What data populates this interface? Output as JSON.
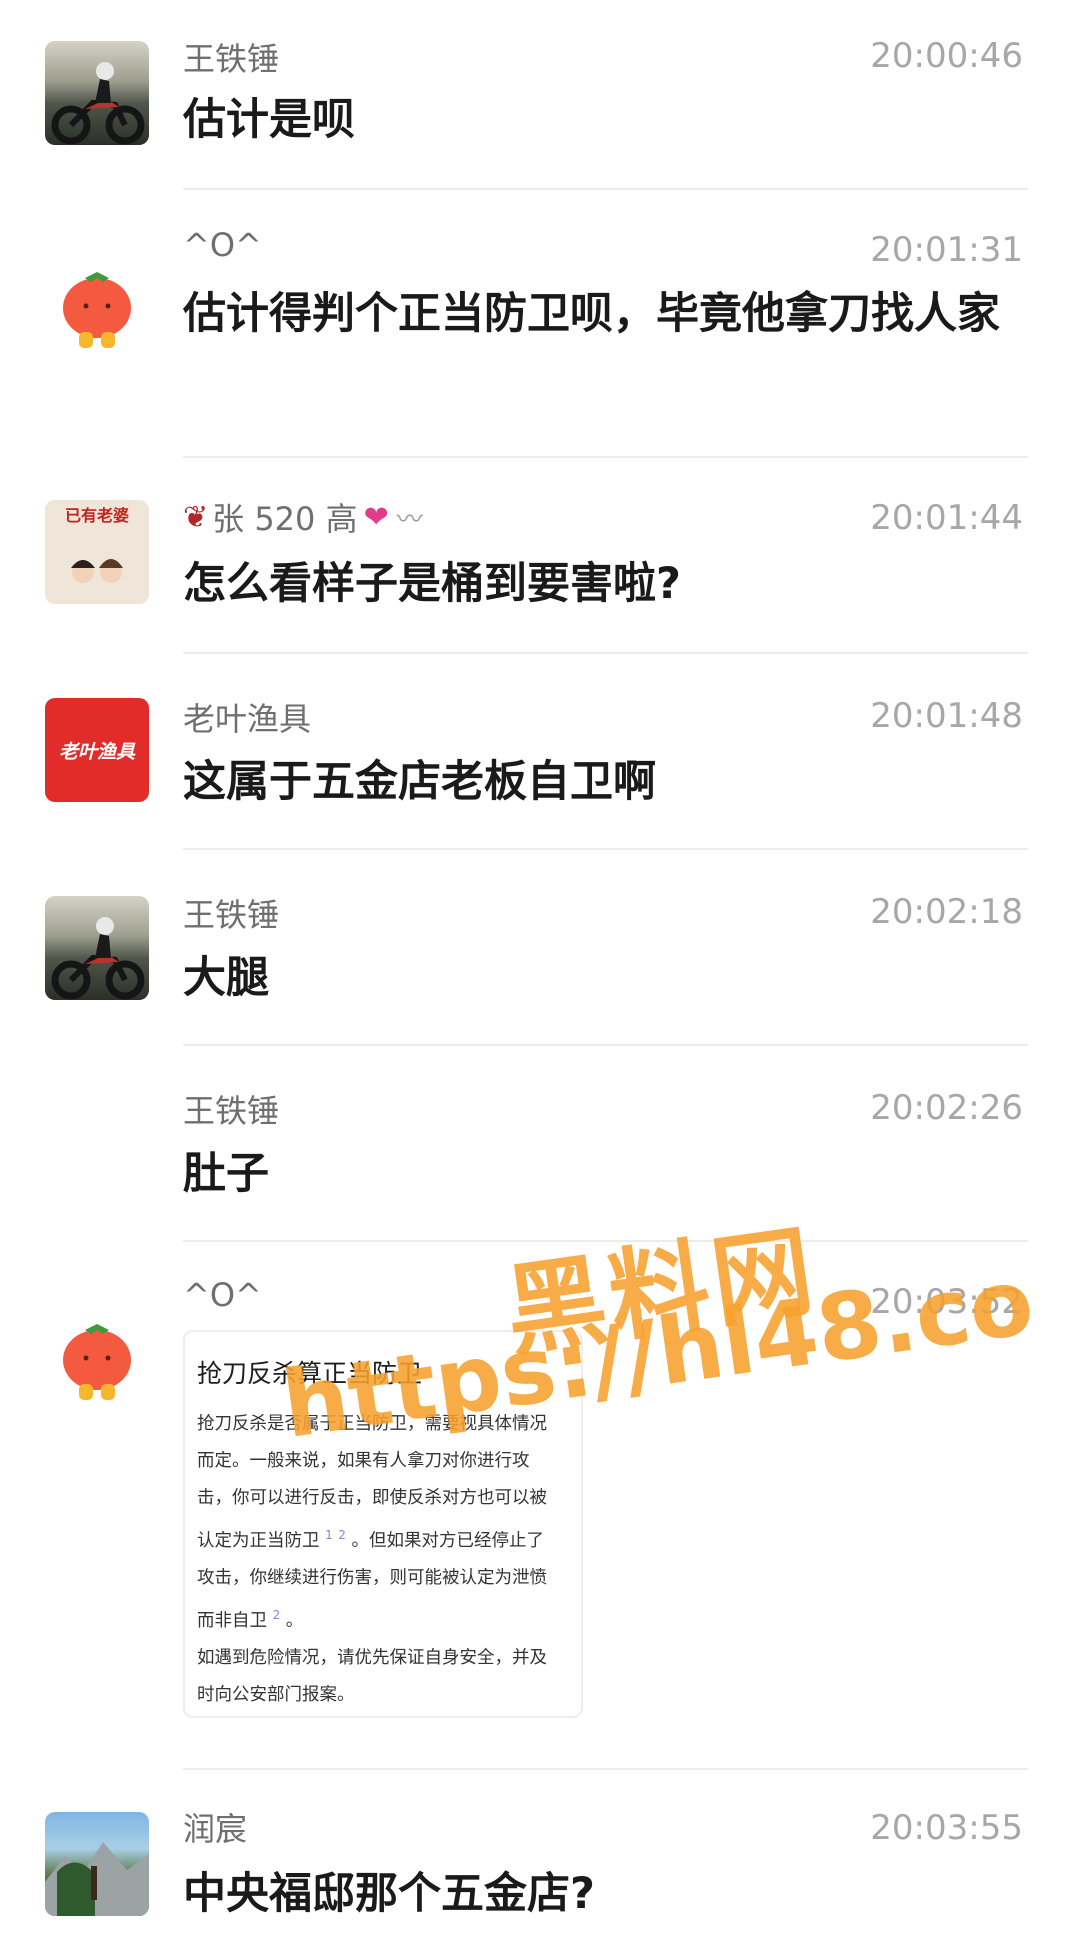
{
  "messages": [
    {
      "name": "王铁锤",
      "time": "20:00:46",
      "text": "估计是呗",
      "avatar": "motorcycle-avatar"
    },
    {
      "name": "^O^",
      "time": "20:01:31",
      "text": "估计得判个正当防卫呗，毕竟他拿刀找人家",
      "avatar": "tomato-avatar"
    },
    {
      "name": "张 520 高",
      "time": "20:01:44",
      "text": "怎么看样子是桶到要害啦?",
      "avatar": "couple-avatar",
      "avatar_text": "已有老婆"
    },
    {
      "name": "老叶渔具",
      "time": "20:01:48",
      "text": "这属于五金店老板自卫啊",
      "avatar": "shop-logo-avatar",
      "avatar_text": "老叶渔具"
    },
    {
      "name": "王铁锤",
      "time": "20:02:18",
      "text": "大腿",
      "avatar": "motorcycle-avatar"
    },
    {
      "name": "王铁锤",
      "time": "20:02:26",
      "text": "肚子"
    },
    {
      "name": "^O^",
      "time": "20:03:52",
      "avatar": "tomato-avatar"
    },
    {
      "name": "润宸",
      "time": "20:03:55",
      "text": "中央福邸那个五金店?",
      "avatar": "mountain-avatar"
    }
  ],
  "card": {
    "title": "抢刀反杀算正当防卫",
    "line1": "抢刀反杀是否属于正当防卫，需要视具体情况",
    "line2": "而定。一般来说，如果有人拿刀对你进行攻",
    "line3": "击，你可以进行反击，即使反杀对方也可以被",
    "line4a": "认定为正当防卫",
    "ref1": "1",
    "ref2": "2",
    "line4b": "。但如果对方已经停止了",
    "line5": "攻击，你继续进行伤害，则可能被认定为泄愤",
    "line6a": "而非自卫",
    "ref3": "2",
    "line6b": "。",
    "line7": "如遇到危险情况，请优先保证自身安全，并及",
    "line8": "时向公安部门报案。"
  },
  "watermark": {
    "line1": "黑料网",
    "line2": "https://hl48.co"
  }
}
